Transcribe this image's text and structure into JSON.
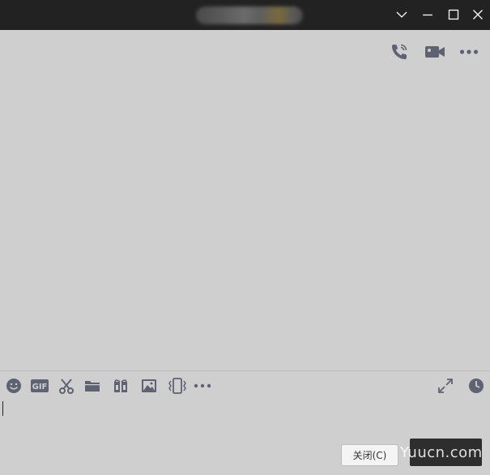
{
  "window": {
    "title": "",
    "controls": [
      "dropdown-icon",
      "minimize-icon",
      "maximize-icon",
      "close-icon"
    ]
  },
  "header_actions": [
    {
      "name": "voice-call-icon"
    },
    {
      "name": "video-call-icon"
    },
    {
      "name": "more-icon"
    }
  ],
  "toolbar": {
    "left": [
      "emoji-icon",
      "gif-icon",
      "scissors-icon",
      "folder-icon",
      "gift-icon",
      "image-icon",
      "vibrate-icon",
      "more-icon"
    ],
    "right": [
      "expand-icon",
      "clock-icon"
    ]
  },
  "input": {
    "value": "",
    "placeholder": ""
  },
  "buttons": {
    "close_label": "关闭(C)",
    "send_label": ""
  },
  "watermark": "Yuucn.com",
  "colors": {
    "titlebar": "#222222",
    "background": "#cfcfcf",
    "icon": "#5f6270",
    "send_button": "#2e2e2e"
  }
}
